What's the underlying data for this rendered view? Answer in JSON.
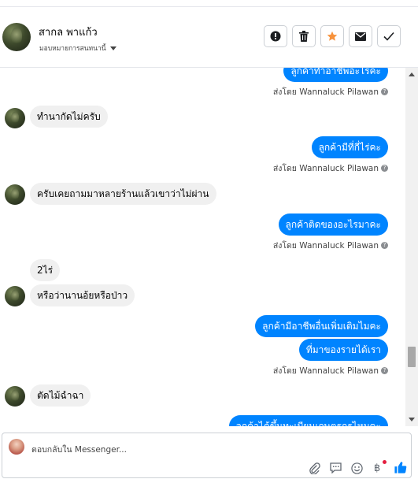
{
  "header": {
    "contact_name": "สากล พาแก้ว",
    "assign_label": "มอบหมายการสนทนานี้",
    "buttons": [
      "mark-spam",
      "delete",
      "star",
      "mark-unread",
      "done"
    ]
  },
  "colors": {
    "outgoing_bubble": "#0084ff",
    "incoming_bubble": "#f0f0f0",
    "star": "#f7923b",
    "like": "#0084ff",
    "notification_dot": "#e41e3f"
  },
  "chat": {
    "messages": [
      {
        "dir": "out",
        "text": "ลูกค้าทำอาชีพอะไรคะ"
      },
      {
        "dir": "sender",
        "text": "ส่งโดย Wannaluck Pilawan"
      },
      {
        "dir": "in",
        "text": "ทำนากัดไม่ครับ"
      },
      {
        "dir": "out",
        "text": "ลูกค้ามีที่กี่ไร่คะ"
      },
      {
        "dir": "sender",
        "text": "ส่งโดย Wannaluck Pilawan"
      },
      {
        "dir": "in",
        "text": "ครับเคยถามมาหลายร้านแล้วเขาว่าไม่ผ่าน"
      },
      {
        "dir": "out",
        "text": "ลูกค้าติดของอะไรมาคะ"
      },
      {
        "dir": "sender",
        "text": "ส่งโดย Wannaluck Pilawan"
      },
      {
        "dir": "in",
        "text": "2ไร่"
      },
      {
        "dir": "in",
        "text": "หรือว่านานอ้ยหรือป่าว"
      },
      {
        "dir": "out",
        "text": "ลูกค้ามีอาชีพอื่นเพิ่มเติมไมคะ"
      },
      {
        "dir": "out",
        "text": "ที่มาของรายได้เรา"
      },
      {
        "dir": "sender",
        "text": "ส่งโดย Wannaluck Pilawan"
      },
      {
        "dir": "in",
        "text": "ตัดไม้ฉำฉา"
      },
      {
        "dir": "out",
        "text": "ลูกค้าได้ขึ้นทะเบียนเกษตรกรไหมคะ"
      }
    ]
  },
  "composer": {
    "placeholder": "ตอบกลับใน Messenger...",
    "tools": [
      "attach-icon",
      "saved-reply-icon",
      "emoji-icon",
      "baht-icon",
      "like-icon"
    ]
  }
}
